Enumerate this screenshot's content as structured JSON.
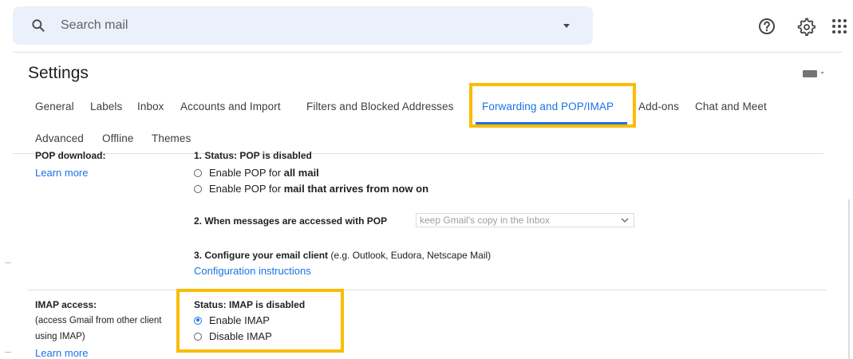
{
  "search": {
    "placeholder": "Search mail",
    "icon": "search-icon",
    "options_icon": "caret-down-icon",
    "background": "#eaf1fb"
  },
  "header_icons": [
    "help-icon",
    "gear-icon",
    "apps-icon"
  ],
  "settings": {
    "title": "Settings",
    "input_tools_icon": "keyboard-icon",
    "tabs": [
      {
        "label": "General",
        "active": false
      },
      {
        "label": "Labels",
        "active": false
      },
      {
        "label": "Inbox",
        "active": false
      },
      {
        "label": "Accounts and Import",
        "active": false
      },
      {
        "label": "Filters and Blocked Addresses",
        "active": false
      },
      {
        "label": "Forwarding and POP/IMAP",
        "active": true
      },
      {
        "label": "Add-ons",
        "active": false
      },
      {
        "label": "Chat and Meet",
        "active": false
      },
      {
        "label": "Advanced",
        "active": false
      },
      {
        "label": "Offline",
        "active": false
      },
      {
        "label": "Themes",
        "active": false
      }
    ]
  },
  "pop": {
    "section_label": "POP download:",
    "learn_more": "Learn more",
    "status": "1. Status: POP is disabled",
    "options": [
      {
        "prefix": "Enable POP for ",
        "bold": "all mail",
        "checked": false
      },
      {
        "prefix": "Enable POP for ",
        "bold": "mail that arrives from now on",
        "checked": false
      }
    ],
    "step2_label": "2. When messages are accessed with POP",
    "step2_select_value": "keep Gmail's copy in the Inbox",
    "step3_label": "3. Configure your email client",
    "step3_note": " (e.g. Outlook, Eudora, Netscape Mail)",
    "config_link": "Configuration instructions"
  },
  "imap": {
    "section_label": "IMAP access:",
    "desc_line1": "(access Gmail from other client",
    "desc_line2": "using IMAP)",
    "learn_more": "Learn more",
    "status": "Status: IMAP is disabled",
    "options": [
      {
        "label": "Enable IMAP",
        "checked": true
      },
      {
        "label": "Disable IMAP",
        "checked": false
      }
    ]
  },
  "colors": {
    "accent": "#1a73e8",
    "highlight": "#fbbc04",
    "text": "#202124"
  }
}
